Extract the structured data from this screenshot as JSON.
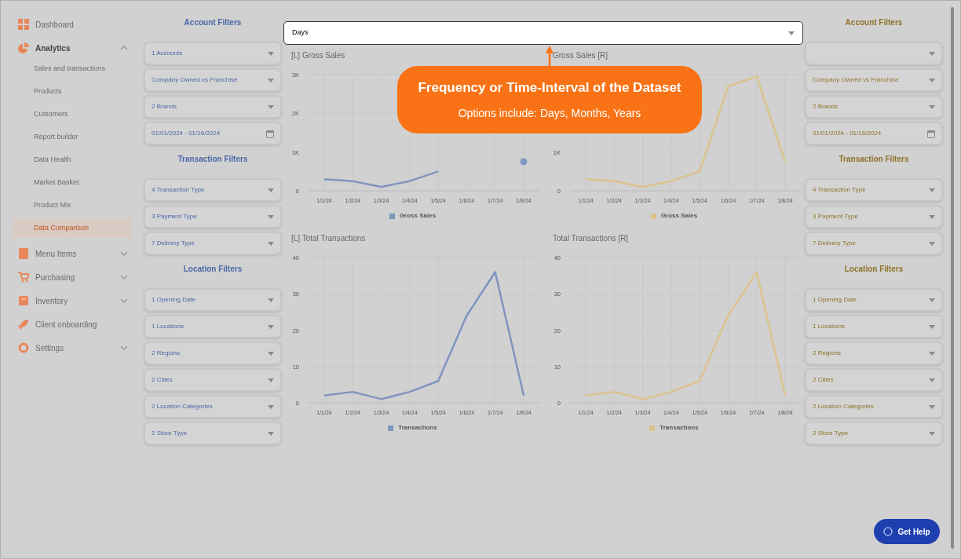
{
  "sidebar": {
    "items": [
      {
        "kind": "link",
        "label": "Dashboard"
      },
      {
        "kind": "group",
        "label": "Analytics",
        "expanded": true,
        "children": [
          {
            "label": "Sales and transactions",
            "selected": false
          },
          {
            "label": "Products",
            "selected": false
          },
          {
            "label": "Customers",
            "selected": false
          },
          {
            "label": "Report builder",
            "selected": false
          },
          {
            "label": "Data Health",
            "selected": false
          },
          {
            "label": "Market Basket",
            "selected": false
          },
          {
            "label": "Product Mix",
            "selected": false
          },
          {
            "label": "Data Comparison",
            "selected": true
          }
        ]
      },
      {
        "kind": "group",
        "label": "Menu Items",
        "expanded": false
      },
      {
        "kind": "group",
        "label": "Purchasing",
        "expanded": false
      },
      {
        "kind": "group",
        "label": "Inventory",
        "expanded": false
      },
      {
        "kind": "link",
        "label": "Client onboarding"
      },
      {
        "kind": "group",
        "label": "Settings",
        "expanded": false
      }
    ]
  },
  "filter_panels": [
    {
      "color": "#4a68a8",
      "sections": [
        {
          "title": "Account Filters",
          "filters": [
            {
              "kind": "select",
              "value": "1 Accounts"
            },
            {
              "kind": "select",
              "value": "Company Owned vs Franchise"
            },
            {
              "kind": "select",
              "value": "2 Brands"
            },
            {
              "kind": "date",
              "value": "01/01/2024 - 01/16/2024"
            }
          ]
        },
        {
          "title": "Transaction Filters",
          "filters": [
            {
              "kind": "select",
              "value": "4 Transaction Type"
            },
            {
              "kind": "select",
              "value": "3 Payment Type"
            },
            {
              "kind": "select",
              "value": "7 Delivery Type"
            }
          ]
        },
        {
          "title": "Location Filters",
          "filters": [
            {
              "kind": "select",
              "value": "1 Opening Date"
            },
            {
              "kind": "select",
              "value": "1 Locations"
            },
            {
              "kind": "select",
              "value": "2 Regions"
            },
            {
              "kind": "select",
              "value": "2 Cities"
            },
            {
              "kind": "select",
              "value": "2 Location Categories"
            },
            {
              "kind": "select",
              "value": "2 Store Type"
            }
          ]
        }
      ]
    },
    {
      "color": "#8f7228",
      "sections": [
        {
          "title": "Account Filters",
          "filters": [
            {
              "kind": "select"
            },
            {
              "kind": "select",
              "value": "Company Owned vs Franchise"
            },
            {
              "kind": "select",
              "value": "2 Brands"
            },
            {
              "kind": "date",
              "value": "01/01/2024 - 01/16/2024"
            }
          ]
        },
        {
          "title": "Transaction Filters",
          "filters": [
            {
              "kind": "select",
              "value": "4 Transaction Type"
            },
            {
              "kind": "select",
              "value": "3 Payment Type"
            },
            {
              "kind": "select",
              "value": "7 Delivery Type"
            }
          ]
        },
        {
          "title": "Location Filters",
          "filters": [
            {
              "kind": "select",
              "value": "1 Opening Date"
            },
            {
              "kind": "select",
              "value": "1 Locations"
            },
            {
              "kind": "select",
              "value": "2 Regions"
            },
            {
              "kind": "select",
              "value": "2 Cities"
            },
            {
              "kind": "select",
              "value": "2 Location Categories"
            },
            {
              "kind": "select",
              "value": "2 Store Type"
            }
          ]
        }
      ]
    }
  ],
  "interval_select": {
    "value": "Days"
  },
  "callout": {
    "title": "Frequency or Time-Interval of the Dataset",
    "text": "Options include: Days, Months, Years"
  },
  "charts": [
    {
      "chart_data": {
        "type": "line",
        "title": "[L] Gross Sales",
        "grid": true,
        "categories": [
          "1/1/24",
          "1/2/24",
          "1/3/24",
          "1/4/24",
          "1/5/24",
          "1/6/24",
          "1/7/24",
          "1/8/24"
        ],
        "series": [
          {
            "name": "Gross Sales",
            "color": "#7f95c0",
            "values": [
              300,
              250,
              100,
              250,
              500,
              null,
              null,
              750
            ]
          }
        ],
        "ylim": [
          0,
          3000
        ],
        "yticks": [
          {
            "value": 0,
            "label": "0"
          },
          {
            "value": 1000,
            "label": "1K"
          },
          {
            "value": 2000,
            "label": "2K"
          },
          {
            "value": 3000,
            "label": "3K"
          }
        ]
      }
    },
    {
      "chart_data": {
        "type": "line",
        "title": "Gross Sales [R]",
        "grid": true,
        "categories": [
          "1/1/24",
          "1/2/24",
          "1/3/24",
          "1/4/24",
          "1/5/24",
          "1/6/24",
          "1/7/24",
          "1/8/24"
        ],
        "series": [
          {
            "name": "Gross Sales",
            "color": "#dcc38e",
            "values": [
              300,
              250,
              100,
              250,
              500,
              2700,
              2950,
              750
            ]
          }
        ],
        "ylim": [
          0,
          3000
        ],
        "yticks": [
          {
            "value": 0,
            "label": "0"
          },
          {
            "value": 1000,
            "label": "1K"
          }
        ]
      }
    },
    {
      "chart_data": {
        "type": "line",
        "title": "[L] Total Transactions",
        "grid": true,
        "categories": [
          "1/1/24",
          "1/2/24",
          "1/3/24",
          "1/4/24",
          "1/5/24",
          "1/6/24",
          "1/7/24",
          "1/8/24"
        ],
        "series": [
          {
            "name": "Transactions",
            "color": "#7f95c0",
            "values": [
              2,
              3,
              1,
              3,
              6,
              24,
              36,
              2
            ]
          }
        ],
        "ylim": [
          0,
          40
        ],
        "yticks": [
          0,
          10,
          20,
          30,
          40
        ]
      }
    },
    {
      "chart_data": {
        "type": "line",
        "title": "Total Transactions [R]",
        "grid": true,
        "categories": [
          "1/1/24",
          "1/2/24",
          "1/3/24",
          "1/4/24",
          "1/5/24",
          "1/6/24",
          "1/7/24",
          "1/8/24"
        ],
        "series": [
          {
            "name": "Transactions",
            "color": "#dcc38e",
            "values": [
              2,
              3,
              1,
              3,
              6,
              24,
              36,
              2
            ]
          }
        ],
        "ylim": [
          0,
          40
        ],
        "yticks": [
          0,
          10,
          20,
          30,
          40
        ]
      }
    }
  ],
  "help_button": {
    "label": "Get Help"
  }
}
